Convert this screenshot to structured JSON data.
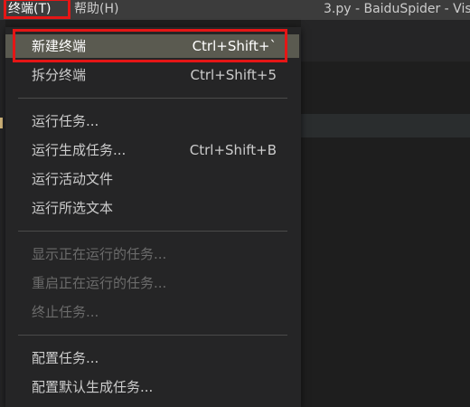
{
  "menubar": {
    "terminal": "终端(T)",
    "help": "帮助(H)",
    "window_title": "3.py - BaiduSpider - Visu"
  },
  "terminal_menu": {
    "groups": [
      [
        {
          "label": "新建终端",
          "shortcut": "Ctrl+Shift+`",
          "state": "selected"
        },
        {
          "label": "拆分终端",
          "shortcut": "Ctrl+Shift+5",
          "state": "enabled"
        }
      ],
      [
        {
          "label": "运行任务...",
          "shortcut": "",
          "state": "enabled"
        },
        {
          "label": "运行生成任务...",
          "shortcut": "Ctrl+Shift+B",
          "state": "enabled"
        },
        {
          "label": "运行活动文件",
          "shortcut": "",
          "state": "enabled"
        },
        {
          "label": "运行所选文本",
          "shortcut": "",
          "state": "enabled"
        }
      ],
      [
        {
          "label": "显示正在运行的任务...",
          "shortcut": "",
          "state": "disabled"
        },
        {
          "label": "重启正在运行的任务...",
          "shortcut": "",
          "state": "disabled"
        },
        {
          "label": "终止任务...",
          "shortcut": "",
          "state": "disabled"
        }
      ],
      [
        {
          "label": "配置任务...",
          "shortcut": "",
          "state": "enabled"
        },
        {
          "label": "配置默认生成任务...",
          "shortcut": "",
          "state": "enabled"
        }
      ]
    ]
  },
  "colors": {
    "menubar_bg": "#3c3c3c",
    "menu_bg": "#252526",
    "selected_bg": "#5a5a50",
    "highlight_outline": "#e51616",
    "disabled_text": "#6b6b6b"
  }
}
